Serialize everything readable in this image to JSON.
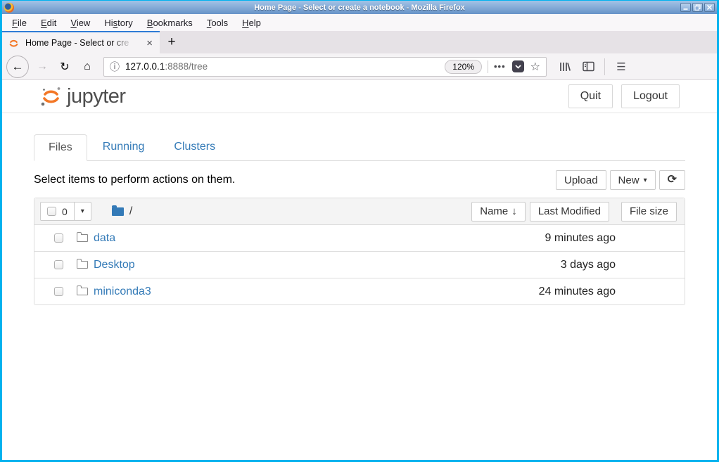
{
  "window": {
    "title": "Home Page - Select or create a notebook - Mozilla Firefox"
  },
  "menu_bar": {
    "items": [
      {
        "pre": "",
        "key": "F",
        "post": "ile"
      },
      {
        "pre": "",
        "key": "E",
        "post": "dit"
      },
      {
        "pre": "",
        "key": "V",
        "post": "iew"
      },
      {
        "pre": "Hi",
        "key": "s",
        "post": "tory"
      },
      {
        "pre": "",
        "key": "B",
        "post": "ookmarks"
      },
      {
        "pre": "",
        "key": "T",
        "post": "ools"
      },
      {
        "pre": "",
        "key": "H",
        "post": "elp"
      }
    ]
  },
  "tab_strip": {
    "tab_title": "Home Page - Select or cre",
    "close_glyph": "×",
    "new_tab_glyph": "+"
  },
  "toolbar": {
    "back_glyph": "←",
    "forward_glyph": "→",
    "reload_glyph": "↻",
    "home_glyph": "⌂",
    "info_glyph": "ⓘ",
    "url_host": "127.0.0.1",
    "url_rest": ":8888/tree",
    "zoom_level": "120%",
    "page_actions_glyph": "•••",
    "star_glyph": "☆",
    "hamburger_glyph": "☰"
  },
  "jupyter": {
    "brand": "jupyter",
    "quit_label": "Quit",
    "logout_label": "Logout",
    "tabs": [
      {
        "label": "Files"
      },
      {
        "label": "Running"
      },
      {
        "label": "Clusters"
      }
    ],
    "action_bar": {
      "message": "Select items to perform actions on them.",
      "upload_label": "Upload",
      "new_label": "New",
      "new_caret": "▾",
      "refresh_glyph": "⟳"
    },
    "list": {
      "selected_count": "0",
      "dropdown_caret": "▾",
      "path": "/",
      "sort_name_label": "Name",
      "sort_arrow": "↓",
      "last_modified_label": "Last Modified",
      "file_size_label": "File size",
      "rows": [
        {
          "name": "data",
          "modified": "9 minutes ago"
        },
        {
          "name": "Desktop",
          "modified": "3 days ago"
        },
        {
          "name": "miniconda3",
          "modified": "24 minutes ago"
        }
      ]
    }
  },
  "colors": {
    "window_border": "#00b2ee",
    "tab_accent": "#2f7cd6",
    "jupyter_orange": "#f37726",
    "link_blue": "#337ab7"
  }
}
